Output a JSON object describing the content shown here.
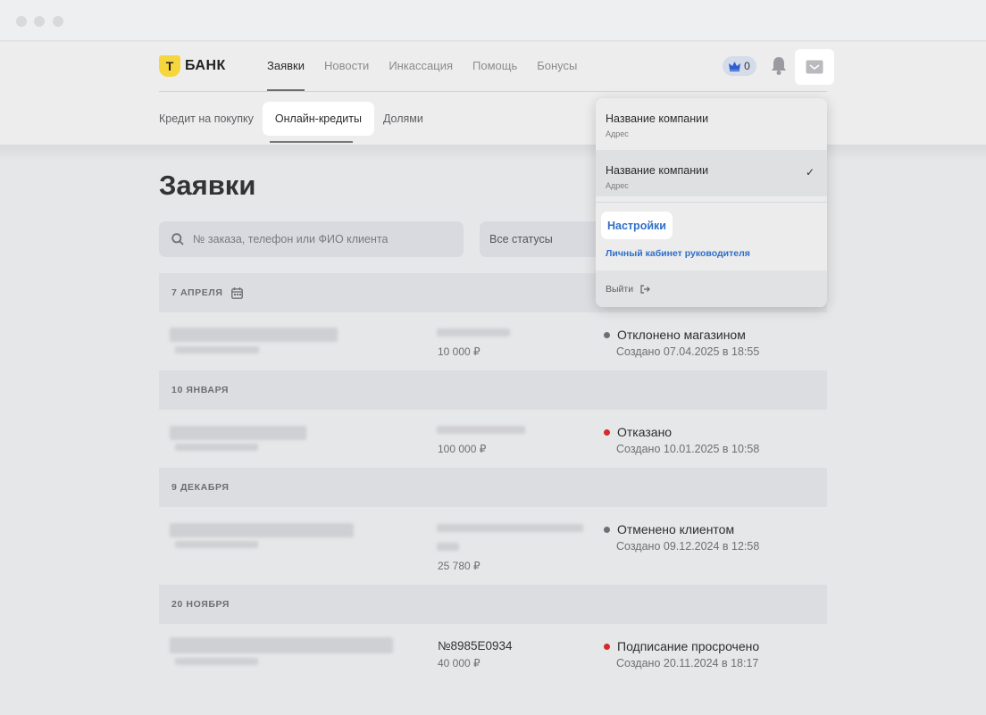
{
  "brand": {
    "logo_letter": "Т",
    "name": "БАНК"
  },
  "nav": {
    "items": [
      {
        "label": "Заявки",
        "active": true
      },
      {
        "label": "Новости",
        "active": false
      },
      {
        "label": "Инкассация",
        "active": false
      },
      {
        "label": "Помощь",
        "active": false
      },
      {
        "label": "Бонусы",
        "active": false
      }
    ]
  },
  "header": {
    "crown_count": "0",
    "icons": [
      "crown-icon",
      "bell-icon",
      "inbox-icon"
    ]
  },
  "subnav": {
    "items": [
      {
        "label": "Кредит на покупку",
        "active": false
      },
      {
        "label": "Онлайн-кредиты",
        "active": true
      },
      {
        "label": "Долями",
        "active": false
      }
    ]
  },
  "page": {
    "title": "Заявки"
  },
  "search": {
    "placeholder": "№ заказа, телефон или ФИО клиента"
  },
  "filter": {
    "status_label": "Все статусы"
  },
  "groups": [
    {
      "date": "7 АПРЕЛЯ",
      "amount": "10 000 ₽",
      "order_no": "",
      "status": "Отклонено магазином",
      "status_color": "#6d6f78",
      "created": "Создано 07.04.2025 в 18:55"
    },
    {
      "date": "10 ЯНВАРЯ",
      "amount": "100 000 ₽",
      "order_no": "",
      "status": "Отказано",
      "status_color": "#d42a2a",
      "created": "Создано 10.01.2025 в 10:58"
    },
    {
      "date": "9 ДЕКАБРЯ",
      "amount": "25 780 ₽",
      "order_no": "",
      "status": "Отменено клиентом",
      "status_color": "#6d6f78",
      "created": "Создано 09.12.2024 в 12:58"
    },
    {
      "date": "20 НОЯБРЯ",
      "amount": "40 000 ₽",
      "order_no": "№8985E0934",
      "status": "Подписание просрочено",
      "status_color": "#d42a2a",
      "created": "Создано 20.11.2024 в 18:17"
    }
  ],
  "dropdown": {
    "companies": [
      {
        "name": "Название компании",
        "address": "Адрес",
        "selected": false
      },
      {
        "name": "Название компании",
        "address": "Адрес",
        "selected": true
      }
    ],
    "check": "✓",
    "settings_label": "Настройки",
    "cabinet_label": "Личный кабинет руководителя",
    "logout_label": "Выйти"
  },
  "colors": {
    "accent_yellow": "#f5d63d",
    "link_blue": "#2f6fc7",
    "status_red": "#d42a2a",
    "status_gray": "#6d6f78"
  }
}
